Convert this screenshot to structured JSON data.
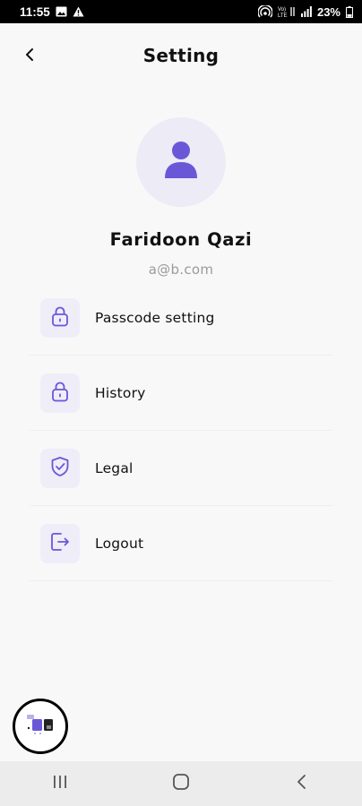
{
  "status_bar": {
    "time": "11:55",
    "battery": "23%",
    "icons_left": [
      "image-icon",
      "warning-icon"
    ],
    "icons_right": [
      "hotspot-icon",
      "volte-icon",
      "signal-icon",
      "battery-icon"
    ]
  },
  "header": {
    "title": "Setting"
  },
  "profile": {
    "name": "Faridoon Qazi",
    "email": "a@b.com"
  },
  "menu": {
    "items": [
      {
        "label": "Passcode setting",
        "icon": "lock-icon"
      },
      {
        "label": "History",
        "icon": "lock-icon"
      },
      {
        "label": "Legal",
        "icon": "shield-check-icon"
      },
      {
        "label": "Logout",
        "icon": "logout-icon"
      }
    ]
  },
  "colors": {
    "accent": "#6a57d8",
    "icon_bg": "#efedf8",
    "avatar_bg": "#ecebf6",
    "background": "#f8f8f9",
    "muted_text": "#9b9b9b"
  },
  "nav_bar": {
    "buttons": [
      "recent-apps-icon",
      "home-icon",
      "back-icon"
    ]
  }
}
